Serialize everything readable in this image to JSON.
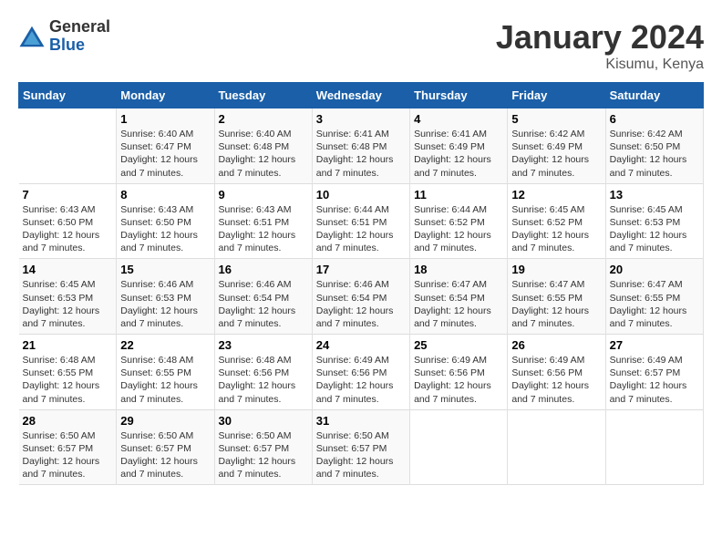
{
  "logo": {
    "general": "General",
    "blue": "Blue"
  },
  "title": "January 2024",
  "location": "Kisumu, Kenya",
  "days_of_week": [
    "Sunday",
    "Monday",
    "Tuesday",
    "Wednesday",
    "Thursday",
    "Friday",
    "Saturday"
  ],
  "weeks": [
    [
      {
        "day": "",
        "sunrise": "",
        "sunset": "",
        "daylight": ""
      },
      {
        "day": "1",
        "sunrise": "Sunrise: 6:40 AM",
        "sunset": "Sunset: 6:47 PM",
        "daylight": "Daylight: 12 hours and 7 minutes."
      },
      {
        "day": "2",
        "sunrise": "Sunrise: 6:40 AM",
        "sunset": "Sunset: 6:48 PM",
        "daylight": "Daylight: 12 hours and 7 minutes."
      },
      {
        "day": "3",
        "sunrise": "Sunrise: 6:41 AM",
        "sunset": "Sunset: 6:48 PM",
        "daylight": "Daylight: 12 hours and 7 minutes."
      },
      {
        "day": "4",
        "sunrise": "Sunrise: 6:41 AM",
        "sunset": "Sunset: 6:49 PM",
        "daylight": "Daylight: 12 hours and 7 minutes."
      },
      {
        "day": "5",
        "sunrise": "Sunrise: 6:42 AM",
        "sunset": "Sunset: 6:49 PM",
        "daylight": "Daylight: 12 hours and 7 minutes."
      },
      {
        "day": "6",
        "sunrise": "Sunrise: 6:42 AM",
        "sunset": "Sunset: 6:50 PM",
        "daylight": "Daylight: 12 hours and 7 minutes."
      }
    ],
    [
      {
        "day": "7",
        "sunrise": "Sunrise: 6:43 AM",
        "sunset": "Sunset: 6:50 PM",
        "daylight": "Daylight: 12 hours and 7 minutes."
      },
      {
        "day": "8",
        "sunrise": "Sunrise: 6:43 AM",
        "sunset": "Sunset: 6:50 PM",
        "daylight": "Daylight: 12 hours and 7 minutes."
      },
      {
        "day": "9",
        "sunrise": "Sunrise: 6:43 AM",
        "sunset": "Sunset: 6:51 PM",
        "daylight": "Daylight: 12 hours and 7 minutes."
      },
      {
        "day": "10",
        "sunrise": "Sunrise: 6:44 AM",
        "sunset": "Sunset: 6:51 PM",
        "daylight": "Daylight: 12 hours and 7 minutes."
      },
      {
        "day": "11",
        "sunrise": "Sunrise: 6:44 AM",
        "sunset": "Sunset: 6:52 PM",
        "daylight": "Daylight: 12 hours and 7 minutes."
      },
      {
        "day": "12",
        "sunrise": "Sunrise: 6:45 AM",
        "sunset": "Sunset: 6:52 PM",
        "daylight": "Daylight: 12 hours and 7 minutes."
      },
      {
        "day": "13",
        "sunrise": "Sunrise: 6:45 AM",
        "sunset": "Sunset: 6:53 PM",
        "daylight": "Daylight: 12 hours and 7 minutes."
      }
    ],
    [
      {
        "day": "14",
        "sunrise": "Sunrise: 6:45 AM",
        "sunset": "Sunset: 6:53 PM",
        "daylight": "Daylight: 12 hours and 7 minutes."
      },
      {
        "day": "15",
        "sunrise": "Sunrise: 6:46 AM",
        "sunset": "Sunset: 6:53 PM",
        "daylight": "Daylight: 12 hours and 7 minutes."
      },
      {
        "day": "16",
        "sunrise": "Sunrise: 6:46 AM",
        "sunset": "Sunset: 6:54 PM",
        "daylight": "Daylight: 12 hours and 7 minutes."
      },
      {
        "day": "17",
        "sunrise": "Sunrise: 6:46 AM",
        "sunset": "Sunset: 6:54 PM",
        "daylight": "Daylight: 12 hours and 7 minutes."
      },
      {
        "day": "18",
        "sunrise": "Sunrise: 6:47 AM",
        "sunset": "Sunset: 6:54 PM",
        "daylight": "Daylight: 12 hours and 7 minutes."
      },
      {
        "day": "19",
        "sunrise": "Sunrise: 6:47 AM",
        "sunset": "Sunset: 6:55 PM",
        "daylight": "Daylight: 12 hours and 7 minutes."
      },
      {
        "day": "20",
        "sunrise": "Sunrise: 6:47 AM",
        "sunset": "Sunset: 6:55 PM",
        "daylight": "Daylight: 12 hours and 7 minutes."
      }
    ],
    [
      {
        "day": "21",
        "sunrise": "Sunrise: 6:48 AM",
        "sunset": "Sunset: 6:55 PM",
        "daylight": "Daylight: 12 hours and 7 minutes."
      },
      {
        "day": "22",
        "sunrise": "Sunrise: 6:48 AM",
        "sunset": "Sunset: 6:55 PM",
        "daylight": "Daylight: 12 hours and 7 minutes."
      },
      {
        "day": "23",
        "sunrise": "Sunrise: 6:48 AM",
        "sunset": "Sunset: 6:56 PM",
        "daylight": "Daylight: 12 hours and 7 minutes."
      },
      {
        "day": "24",
        "sunrise": "Sunrise: 6:49 AM",
        "sunset": "Sunset: 6:56 PM",
        "daylight": "Daylight: 12 hours and 7 minutes."
      },
      {
        "day": "25",
        "sunrise": "Sunrise: 6:49 AM",
        "sunset": "Sunset: 6:56 PM",
        "daylight": "Daylight: 12 hours and 7 minutes."
      },
      {
        "day": "26",
        "sunrise": "Sunrise: 6:49 AM",
        "sunset": "Sunset: 6:56 PM",
        "daylight": "Daylight: 12 hours and 7 minutes."
      },
      {
        "day": "27",
        "sunrise": "Sunrise: 6:49 AM",
        "sunset": "Sunset: 6:57 PM",
        "daylight": "Daylight: 12 hours and 7 minutes."
      }
    ],
    [
      {
        "day": "28",
        "sunrise": "Sunrise: 6:50 AM",
        "sunset": "Sunset: 6:57 PM",
        "daylight": "Daylight: 12 hours and 7 minutes."
      },
      {
        "day": "29",
        "sunrise": "Sunrise: 6:50 AM",
        "sunset": "Sunset: 6:57 PM",
        "daylight": "Daylight: 12 hours and 7 minutes."
      },
      {
        "day": "30",
        "sunrise": "Sunrise: 6:50 AM",
        "sunset": "Sunset: 6:57 PM",
        "daylight": "Daylight: 12 hours and 7 minutes."
      },
      {
        "day": "31",
        "sunrise": "Sunrise: 6:50 AM",
        "sunset": "Sunset: 6:57 PM",
        "daylight": "Daylight: 12 hours and 7 minutes."
      },
      {
        "day": "",
        "sunrise": "",
        "sunset": "",
        "daylight": ""
      },
      {
        "day": "",
        "sunrise": "",
        "sunset": "",
        "daylight": ""
      },
      {
        "day": "",
        "sunrise": "",
        "sunset": "",
        "daylight": ""
      }
    ]
  ]
}
